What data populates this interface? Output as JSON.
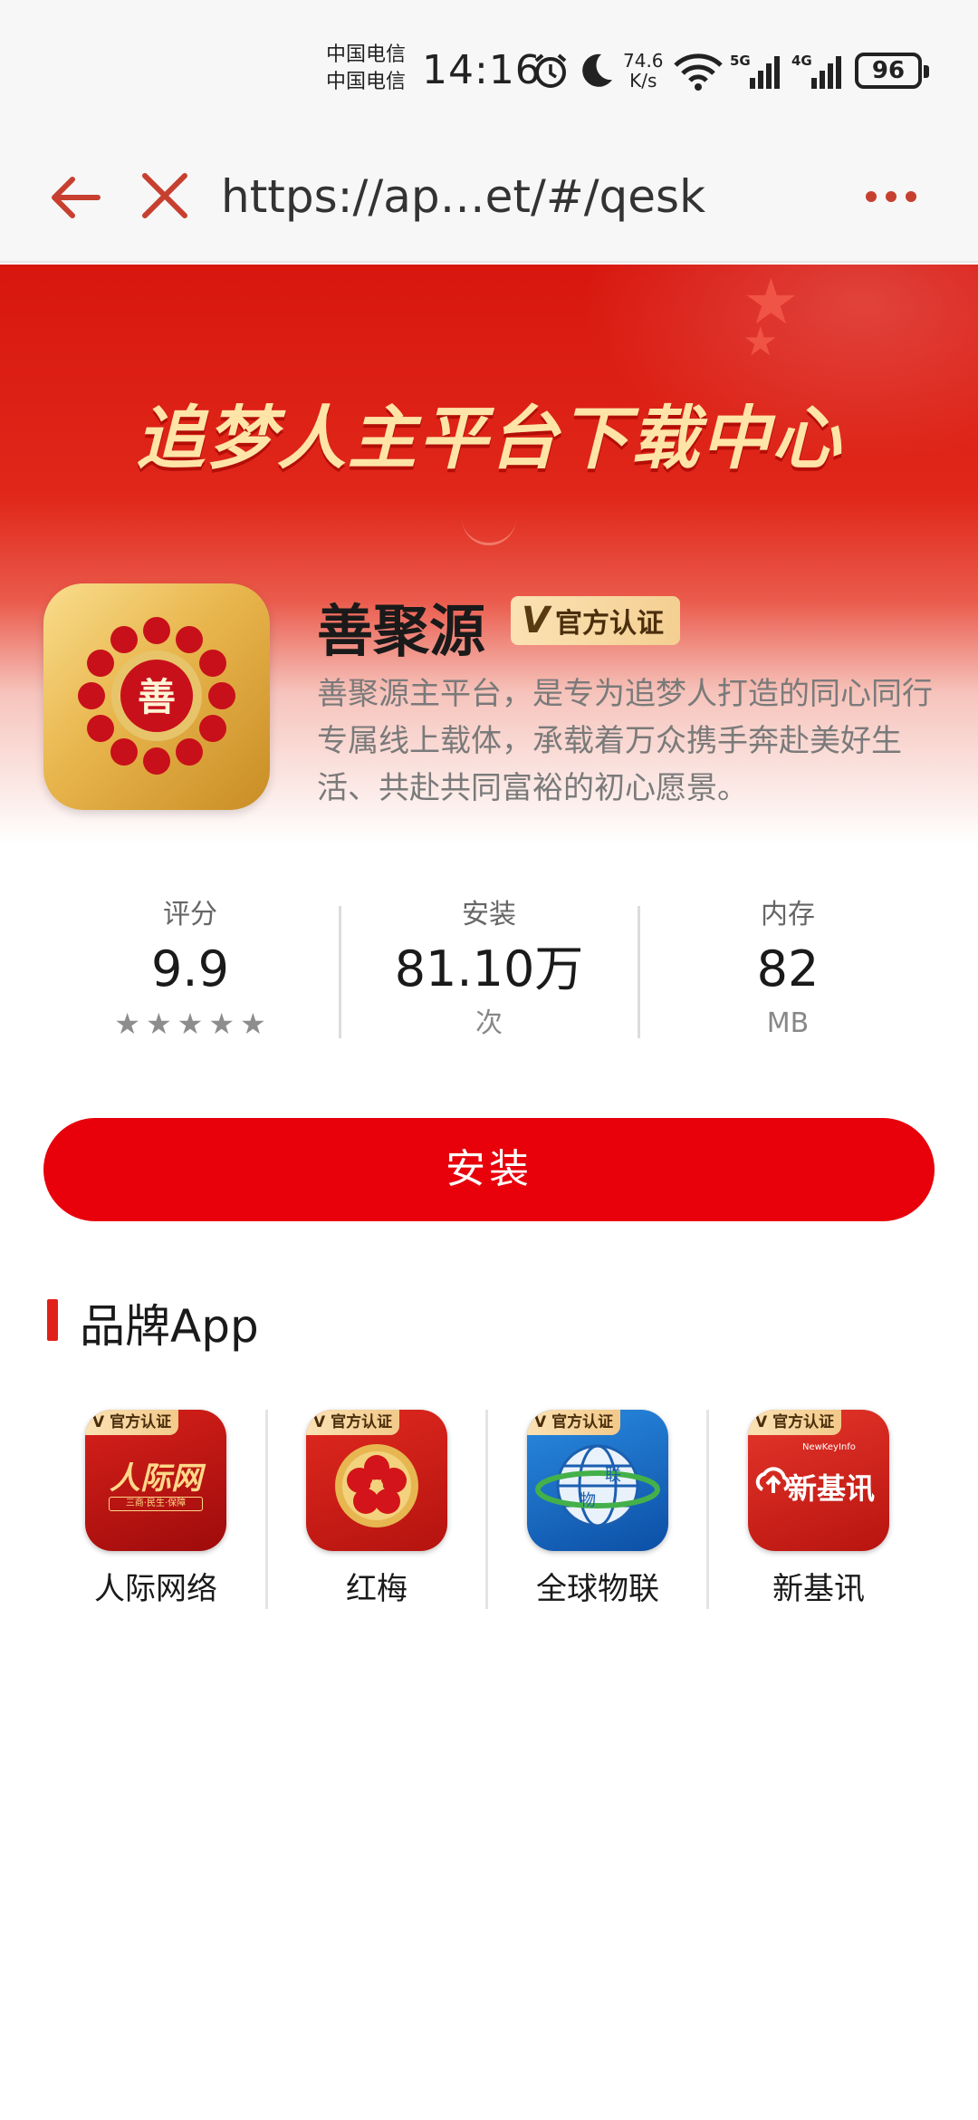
{
  "status_bar": {
    "carrier_1": "中国电信",
    "carrier_2": "中国电信",
    "time": "14:16",
    "speed_value": "74.6",
    "speed_unit": "K/s",
    "battery": "96",
    "net_1": "5G",
    "net_2": "4G"
  },
  "browser": {
    "url": "https://ap…et/#/qesk"
  },
  "banner": {
    "title": "追梦人主平台下载中心"
  },
  "app": {
    "name": "善聚源",
    "badge": "官方认证",
    "badge_v": "V",
    "description": "善聚源主平台，是专为追梦人打造的同心同行专属线上载体，承载着万众携手奔赴美好生活、共赴共同富裕的初心愿景。"
  },
  "stats": {
    "rating": {
      "label": "评分",
      "value": "9.9",
      "stars": 5
    },
    "installs": {
      "label": "安装",
      "value": "81.10万",
      "sub": "次"
    },
    "size": {
      "label": "内存",
      "value": "82",
      "sub": "MB"
    }
  },
  "install_button": {
    "label": "安装"
  },
  "brand_section": {
    "title": "品牌App",
    "badge_text": "V 官方认证",
    "apps": [
      {
        "name": "人际网络",
        "icon_text": "人际网",
        "icon_sub": "三商·民生·保障"
      },
      {
        "name": "红梅"
      },
      {
        "name": "全球物联",
        "icon_text_1": "物",
        "icon_text_2": "联"
      },
      {
        "name": "新基讯",
        "icon_text": "新基讯",
        "icon_sub": "NewKeyInfo"
      }
    ]
  },
  "colors": {
    "primary_red": "#e8000b",
    "banner_red": "#d8170f",
    "gold": "#e8b54c"
  }
}
